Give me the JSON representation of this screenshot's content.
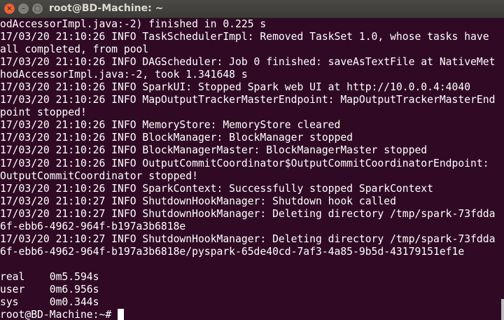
{
  "window": {
    "title": "root@BD-Machine: ~",
    "close_icon": "close-icon",
    "minimize_icon": "minimize-icon",
    "maximize_icon": "maximize-icon"
  },
  "terminal": {
    "lines": [
      "odAccessorImpl.java:-2) finished in 0.225 s",
      "17/03/20 21:10:26 INFO TaskSchedulerImpl: Removed TaskSet 1.0, whose tasks have",
      "all completed, from pool",
      "17/03/20 21:10:26 INFO DAGScheduler: Job 0 finished: saveAsTextFile at NativeMet",
      "hodAccessorImpl.java:-2, took 1.341648 s",
      "17/03/20 21:10:26 INFO SparkUI: Stopped Spark web UI at http://10.0.0.4:4040",
      "17/03/20 21:10:26 INFO MapOutputTrackerMasterEndpoint: MapOutputTrackerMasterEnd",
      "point stopped!",
      "17/03/20 21:10:26 INFO MemoryStore: MemoryStore cleared",
      "17/03/20 21:10:26 INFO BlockManager: BlockManager stopped",
      "17/03/20 21:10:26 INFO BlockManagerMaster: BlockManagerMaster stopped",
      "17/03/20 21:10:26 INFO OutputCommitCoordinator$OutputCommitCoordinatorEndpoint:",
      "OutputCommitCoordinator stopped!",
      "17/03/20 21:10:26 INFO SparkContext: Successfully stopped SparkContext",
      "17/03/20 21:10:27 INFO ShutdownHookManager: Shutdown hook called",
      "17/03/20 21:10:27 INFO ShutdownHookManager: Deleting directory /tmp/spark-73fdda",
      "6f-ebb6-4962-964f-b197a3b6818e",
      "17/03/20 21:10:27 INFO ShutdownHookManager: Deleting directory /tmp/spark-73fdda",
      "6f-ebb6-4962-964f-b197a3b6818e/pyspark-65de40cd-7af3-4a85-9b5d-43179151ef1e",
      "",
      "real\t0m5.594s",
      "user\t0m6.956s",
      "sys\t0m0.344s"
    ],
    "prompt": "root@BD-Machine:~# "
  }
}
